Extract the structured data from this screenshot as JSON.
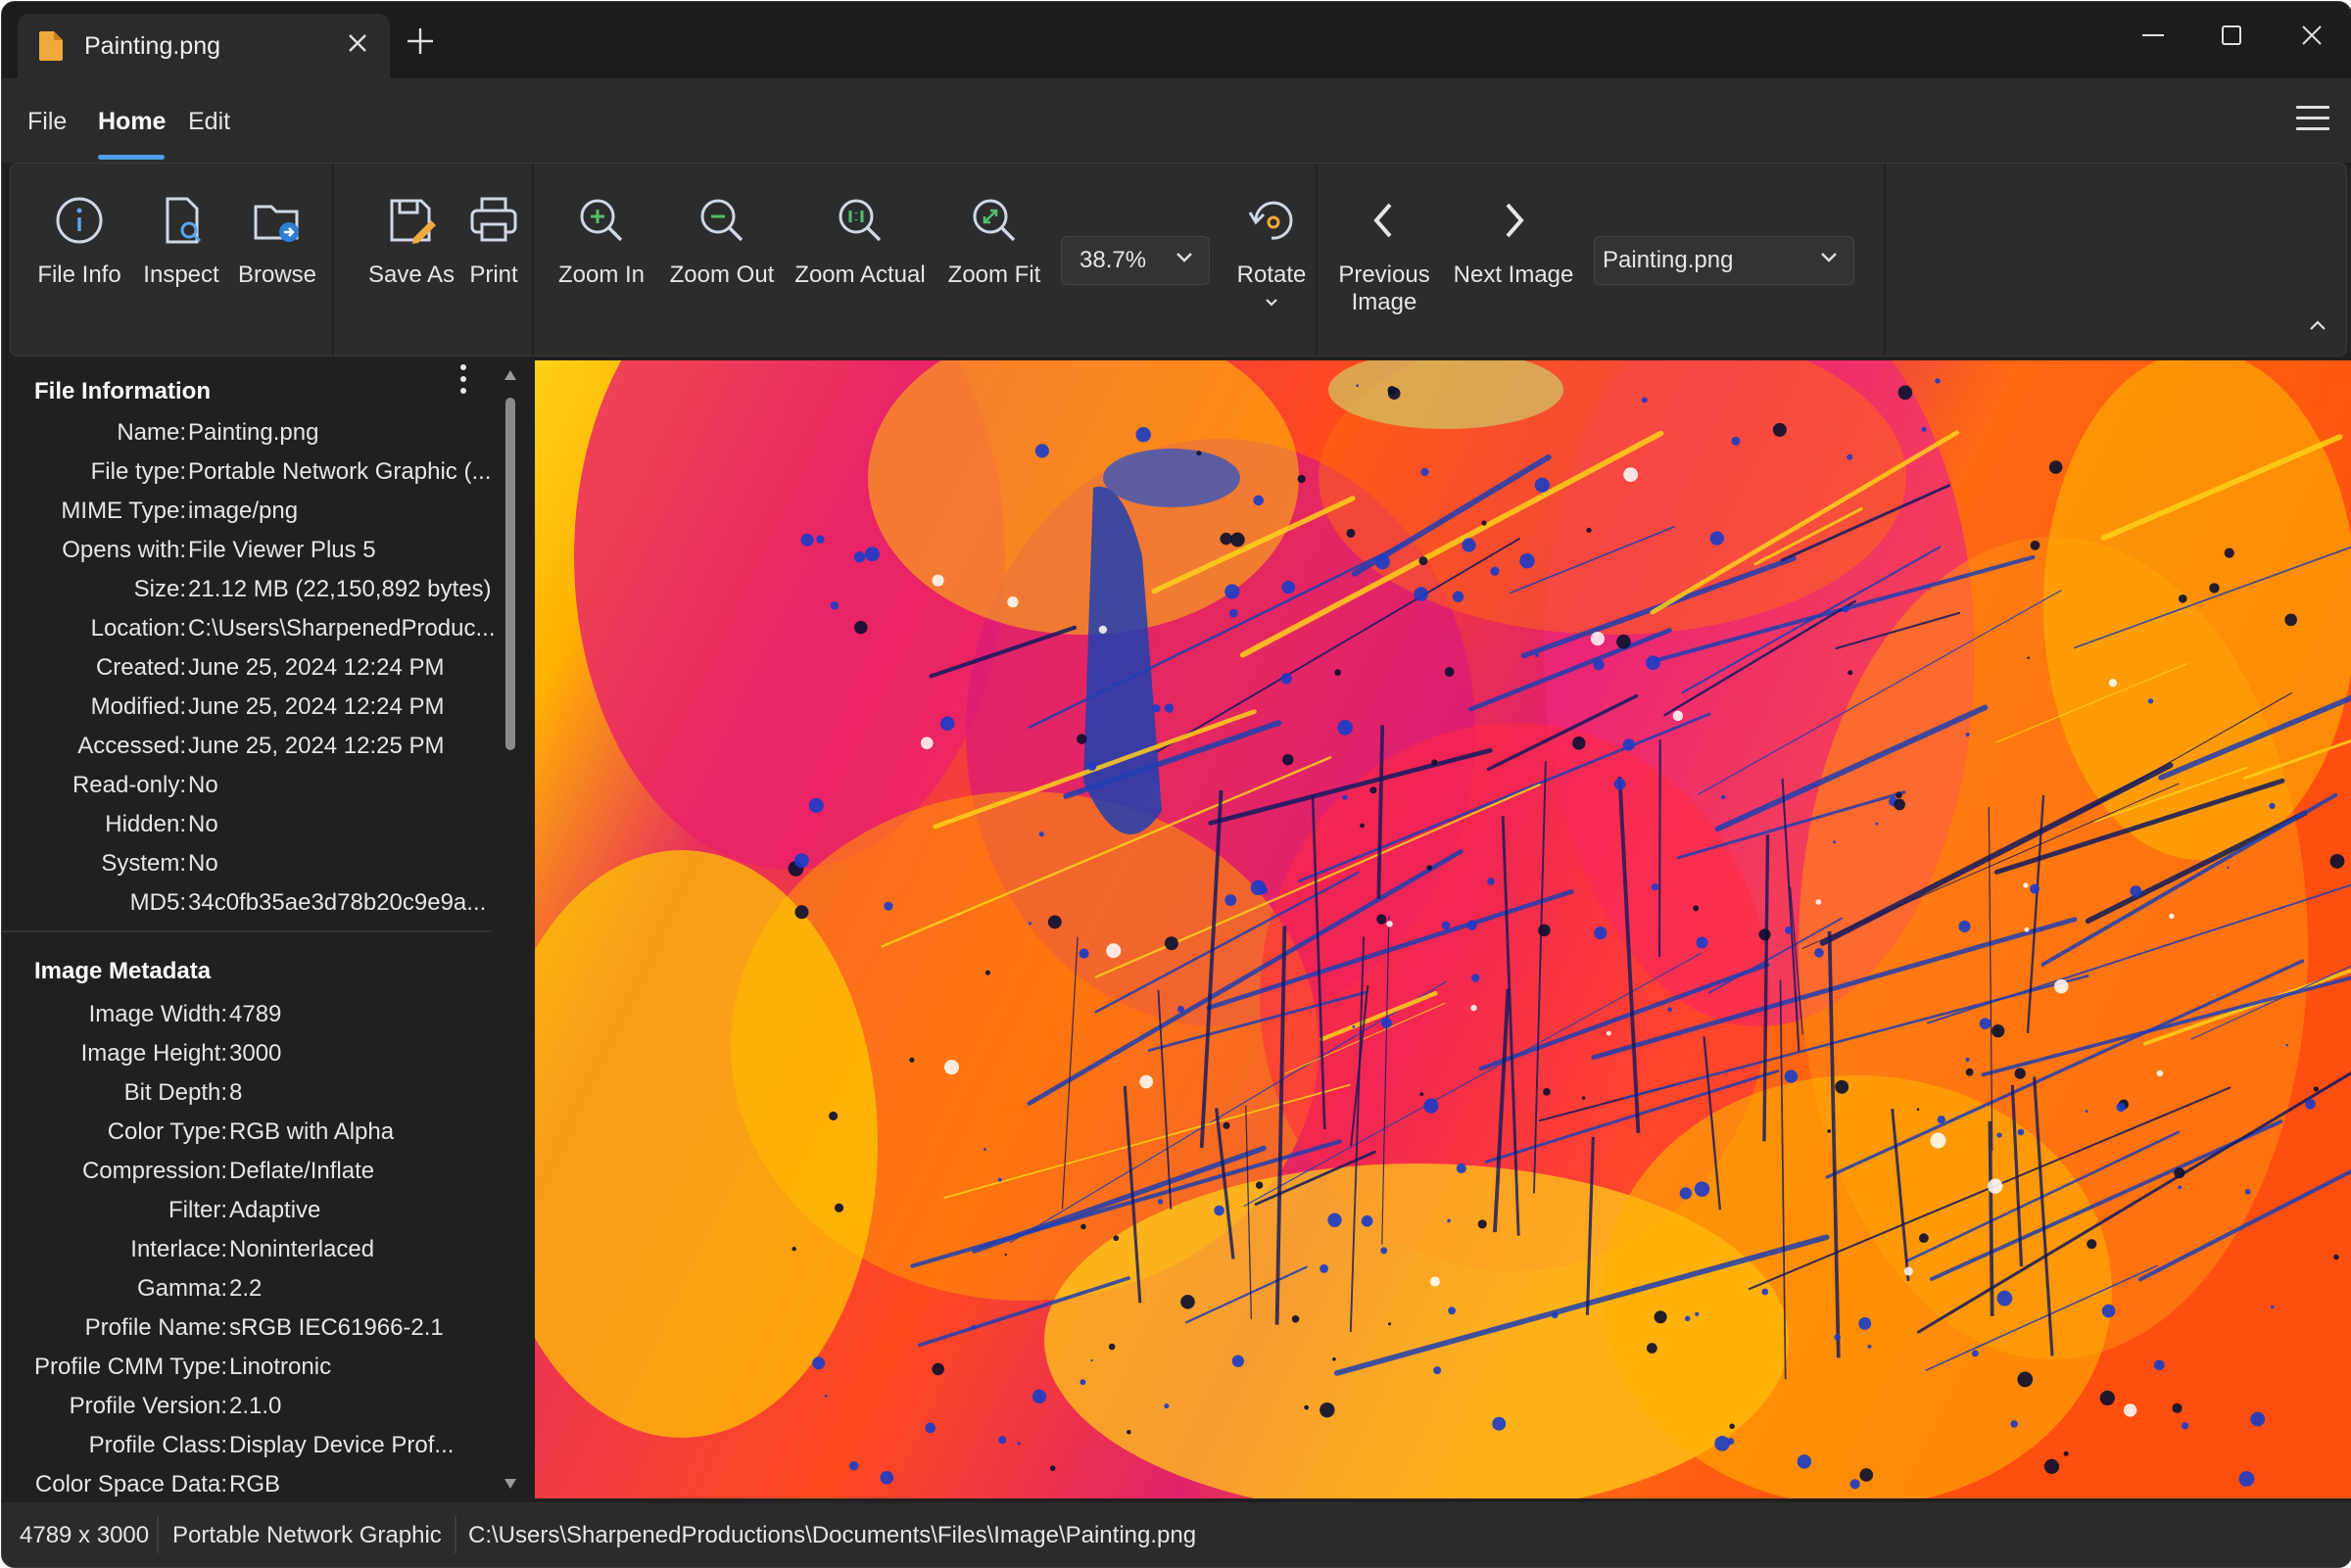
{
  "window": {
    "tab_title": "Painting.png",
    "colors": {
      "accent": "#4c9fe8",
      "file_icon": "#f2a93b",
      "bg": "#202020"
    }
  },
  "menu": {
    "items": [
      "File",
      "Home",
      "Edit"
    ],
    "active": "Home"
  },
  "ribbon": {
    "file_info": "File Info",
    "inspect": "Inspect",
    "browse": "Browse",
    "save_as": "Save As",
    "print": "Print",
    "zoom_in": "Zoom In",
    "zoom_out": "Zoom Out",
    "zoom_actual": "Zoom Actual",
    "zoom_fit": "Zoom Fit",
    "zoom_level": "38.7%",
    "rotate": "Rotate",
    "previous_image_line1": "Previous",
    "previous_image_line2": "Image",
    "next_image": "Next Image",
    "file_selector": "Painting.png"
  },
  "file_information": {
    "title": "File Information",
    "rows": [
      {
        "k": "Name:",
        "v": "Painting.png"
      },
      {
        "k": "File type:",
        "v": "Portable Network Graphic (..."
      },
      {
        "k": "MIME Type:",
        "v": "image/png"
      },
      {
        "k": "Opens with:",
        "v": "File Viewer Plus 5"
      },
      {
        "k": "Size:",
        "v": "21.12 MB (22,150,892 bytes)"
      },
      {
        "k": "Location:",
        "v": "C:\\Users\\SharpenedProduc..."
      },
      {
        "k": "Created:",
        "v": "June 25, 2024 12:24 PM"
      },
      {
        "k": "Modified:",
        "v": "June 25, 2024 12:24 PM"
      },
      {
        "k": "Accessed:",
        "v": "June 25, 2024 12:25 PM"
      },
      {
        "k": "Read-only:",
        "v": "No"
      },
      {
        "k": "Hidden:",
        "v": "No"
      },
      {
        "k": "System:",
        "v": "No"
      },
      {
        "k": "MD5:",
        "v": "34c0fb35ae3d78b20c9e9a..."
      }
    ]
  },
  "image_metadata": {
    "title": "Image Metadata",
    "rows": [
      {
        "k": "Image Width:",
        "v": "4789"
      },
      {
        "k": "Image Height:",
        "v": "3000"
      },
      {
        "k": "Bit Depth:",
        "v": "8"
      },
      {
        "k": "Color Type:",
        "v": "RGB with Alpha"
      },
      {
        "k": "Compression:",
        "v": "Deflate/Inflate"
      },
      {
        "k": "Filter:",
        "v": "Adaptive"
      },
      {
        "k": "Interlace:",
        "v": "Noninterlaced"
      },
      {
        "k": "Gamma:",
        "v": "2.2"
      },
      {
        "k": "Profile Name:",
        "v": "sRGB IEC61966-2.1"
      },
      {
        "k": "Profile CMM Type:",
        "v": "Linotronic"
      },
      {
        "k": "Profile Version:",
        "v": "2.1.0"
      },
      {
        "k": "Profile Class:",
        "v": "Display Device Prof..."
      },
      {
        "k": "Color Space Data:",
        "v": "RGB"
      }
    ]
  },
  "status": {
    "dimensions": "4789 x 3000",
    "file_type": "Portable Network Graphic",
    "path": "C:\\Users\\SharpenedProductions\\Documents\\Files\\Image\\Painting.png"
  }
}
